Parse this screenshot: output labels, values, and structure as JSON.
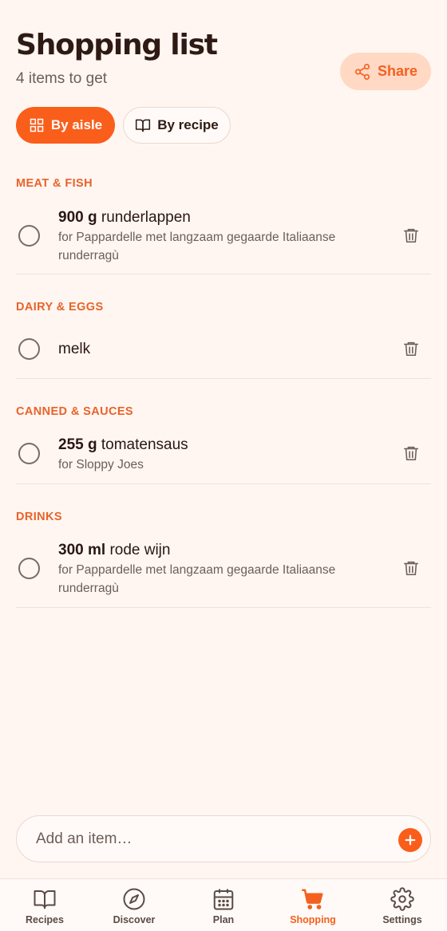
{
  "header": {
    "title": "Shopping list",
    "subtitle": "4 items to get",
    "share_label": "Share"
  },
  "view_toggle": {
    "options": [
      {
        "label": "By aisle",
        "icon": "grid-icon",
        "active": true
      },
      {
        "label": "By recipe",
        "icon": "book-open-icon",
        "active": false
      }
    ]
  },
  "sections": [
    {
      "label": "MEAT & FISH",
      "items": [
        {
          "qty": "900 g",
          "name": "runderlappen",
          "note": "for Pappardelle met langzaam gegaarde Italiaanse runderragù",
          "checked": false
        }
      ]
    },
    {
      "label": "DAIRY & EGGS",
      "items": [
        {
          "qty": "",
          "name": "melk",
          "note": "",
          "checked": false
        }
      ]
    },
    {
      "label": "CANNED & SAUCES",
      "items": [
        {
          "qty": "255 g",
          "name": "tomatensaus",
          "note": "for Sloppy Joes",
          "checked": false
        }
      ]
    },
    {
      "label": "DRINKS",
      "items": [
        {
          "qty": "300 ml",
          "name": "rode wijn",
          "note": "for Pappardelle met langzaam gegaarde Italiaanse runderragù",
          "checked": false
        }
      ]
    }
  ],
  "add_item": {
    "placeholder": "Add an item…"
  },
  "nav": {
    "items": [
      {
        "label": "Recipes",
        "icon": "book-icon",
        "active": false
      },
      {
        "label": "Discover",
        "icon": "compass-icon",
        "active": false
      },
      {
        "label": "Plan",
        "icon": "calendar-icon",
        "active": false
      },
      {
        "label": "Shopping",
        "icon": "cart-icon",
        "active": true
      },
      {
        "label": "Settings",
        "icon": "gear-icon",
        "active": false
      }
    ]
  },
  "colors": {
    "accent": "#fa5e1b",
    "section_label": "#e8632a",
    "background": "#fff6f1",
    "share_bg": "#ffd9c4"
  }
}
